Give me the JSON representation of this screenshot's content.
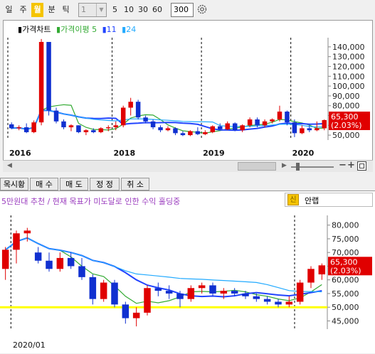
{
  "toolbar": {
    "periods": [
      "일",
      "주",
      "월",
      "분",
      "틱"
    ],
    "active_period": "월",
    "combo_value": "1",
    "intervals": [
      "5",
      "10",
      "30",
      "60"
    ],
    "count": "300"
  },
  "top_chart": {
    "legend": {
      "price": "가격차트",
      "ma_label": "가격이평",
      "ma1": "5",
      "ma2": "11",
      "ma3": "24"
    },
    "y_ticks": [
      "140,000",
      "130,000",
      "120,000",
      "110,000",
      "100,000",
      "90,000",
      "80,000",
      "70,000",
      "60,000",
      "50,000"
    ],
    "x_ticks": [
      "2016",
      "2018",
      "2019",
      "2020"
    ],
    "current_price": "65,300",
    "change_pct": "(2.03%)"
  },
  "tabs": [
    "목시황",
    "매 수",
    "매 도",
    "정 정",
    "취 소"
  ],
  "bottom_panel": {
    "headline": "5만원대 추천 / 현재 목표가 미도달로 인한 수익 홀딩중",
    "sin_badge": "신",
    "sin_label": "안랩",
    "y_ticks": [
      "80,000",
      "75,000",
      "70,000",
      "65,000",
      "60,000",
      "55,000",
      "50,000",
      "45,000"
    ],
    "x_tick": "2020/01",
    "current_price": "65,300",
    "change_pct": "(2.03%)"
  },
  "colors": {
    "up": "#e00000",
    "down": "#1030d0",
    "ma5": "#33aa33",
    "ma11": "#2244ff",
    "ma24": "#22aaff",
    "support": "#ffff00",
    "active": "#f5c400"
  },
  "chart_data": [
    {
      "type": "candlestick",
      "title": "",
      "x_ticks": [
        "2016",
        "2018",
        "2019",
        "2020"
      ],
      "ylim": [
        45000,
        145000
      ],
      "current": 65300,
      "candles": [
        [
          61000,
          63000,
          56000,
          57000
        ],
        [
          57000,
          60000,
          55000,
          58000
        ],
        [
          58000,
          62000,
          52000,
          53000
        ],
        [
          53000,
          65000,
          52000,
          63000
        ],
        [
          63000,
          148000,
          60000,
          145000
        ],
        [
          145000,
          142000,
          70000,
          75000
        ],
        [
          75000,
          78000,
          62000,
          64000
        ],
        [
          64000,
          66000,
          56000,
          58000
        ],
        [
          58000,
          61000,
          54000,
          60000
        ],
        [
          60000,
          60000,
          52000,
          53000
        ],
        [
          53000,
          56000,
          50000,
          55000
        ],
        [
          55000,
          57000,
          52000,
          53000
        ],
        [
          53000,
          58000,
          52000,
          57000
        ],
        [
          57000,
          60000,
          54000,
          58000
        ],
        [
          58000,
          64000,
          55000,
          60000
        ],
        [
          60000,
          80000,
          58000,
          78000
        ],
        [
          78000,
          88000,
          70000,
          84000
        ],
        [
          84000,
          86000,
          66000,
          68000
        ],
        [
          68000,
          70000,
          62000,
          64000
        ],
        [
          64000,
          66000,
          56000,
          58000
        ],
        [
          58000,
          60000,
          53000,
          55000
        ],
        [
          55000,
          59000,
          54000,
          57000
        ],
        [
          57000,
          58000,
          50000,
          52000
        ],
        [
          52000,
          54000,
          49000,
          50000
        ],
        [
          50000,
          55000,
          49000,
          54000
        ],
        [
          54000,
          58000,
          50000,
          51000
        ],
        [
          51000,
          55000,
          50000,
          53000
        ],
        [
          53000,
          60000,
          52000,
          59000
        ],
        [
          59000,
          62000,
          55000,
          56000
        ],
        [
          56000,
          64000,
          55000,
          62000
        ],
        [
          62000,
          63000,
          54000,
          55000
        ],
        [
          55000,
          61000,
          53000,
          60000
        ],
        [
          60000,
          68000,
          58000,
          66000
        ],
        [
          66000,
          68000,
          58000,
          60000
        ],
        [
          60000,
          66000,
          58000,
          64000
        ],
        [
          64000,
          67000,
          62000,
          66000
        ],
        [
          66000,
          80000,
          64000,
          74000
        ],
        [
          74000,
          75000,
          60000,
          63000
        ],
        [
          63000,
          66000,
          48000,
          52000
        ],
        [
          52000,
          60000,
          51000,
          57000
        ],
        [
          57000,
          60000,
          53000,
          55000
        ],
        [
          55000,
          64000,
          54000,
          57000
        ],
        [
          57000,
          66000,
          55000,
          65300
        ]
      ]
    },
    {
      "type": "candlestick",
      "title": "",
      "x_ticks": [
        "2020/01"
      ],
      "ylim": [
        42000,
        82000
      ],
      "current": 65300,
      "support_level": 50000,
      "candles": [
        [
          64000,
          72000,
          60000,
          71000
        ],
        [
          71000,
          78000,
          66000,
          77000
        ],
        [
          77000,
          79000,
          74000,
          78000
        ],
        [
          70000,
          72000,
          66000,
          67000
        ],
        [
          67000,
          70000,
          63000,
          64000
        ],
        [
          64000,
          70000,
          63000,
          68000
        ],
        [
          68000,
          70000,
          64000,
          65000
        ],
        [
          65000,
          68000,
          60000,
          61000
        ],
        [
          61000,
          62000,
          51000,
          53000
        ],
        [
          53000,
          60000,
          52000,
          59000
        ],
        [
          59000,
          60000,
          50000,
          51000
        ],
        [
          51000,
          52000,
          44000,
          46000
        ],
        [
          46000,
          50000,
          43000,
          48000
        ],
        [
          48000,
          58000,
          47000,
          57000
        ],
        [
          57000,
          59000,
          54000,
          56000
        ],
        [
          56000,
          58000,
          53000,
          55000
        ],
        [
          55000,
          56000,
          50000,
          53000
        ],
        [
          53000,
          58000,
          52000,
          57000
        ],
        [
          57000,
          59000,
          55000,
          58000
        ],
        [
          58000,
          59000,
          54000,
          55000
        ],
        [
          55000,
          57000,
          53000,
          56000
        ],
        [
          56000,
          57000,
          54000,
          55000
        ],
        [
          55000,
          56000,
          53000,
          54000
        ],
        [
          54000,
          55000,
          52000,
          53000
        ],
        [
          53000,
          54000,
          51000,
          52000
        ],
        [
          52000,
          53000,
          50000,
          51000
        ],
        [
          51000,
          54000,
          50000,
          52000
        ],
        [
          52000,
          60000,
          51000,
          59000
        ],
        [
          59000,
          65000,
          57000,
          64000
        ],
        [
          62000,
          66000,
          60000,
          65300
        ]
      ]
    }
  ]
}
